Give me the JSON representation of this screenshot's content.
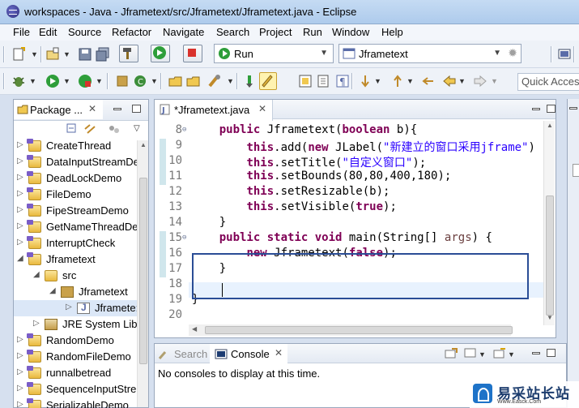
{
  "window": {
    "title": "workspaces - Java - Jframetext/src/Jframetext/Jframetext.java - Eclipse"
  },
  "menu": [
    "File",
    "Edit",
    "Source",
    "Refactor",
    "Navigate",
    "Search",
    "Project",
    "Run",
    "Window",
    "Help"
  ],
  "toolbar": {
    "run_config": "Run",
    "launch_target": "Jframetext",
    "quick_access_placeholder": "Quick Access"
  },
  "package_explorer": {
    "tab_label": "Package ...",
    "items": [
      {
        "label": "CreateThread",
        "level": 0,
        "twisty": "collapsed",
        "icon": "project-icon"
      },
      {
        "label": "DataInputStreamDe",
        "level": 0,
        "twisty": "collapsed",
        "icon": "project-icon"
      },
      {
        "label": "DeadLockDemo",
        "level": 0,
        "twisty": "collapsed",
        "icon": "project-icon"
      },
      {
        "label": "FileDemo",
        "level": 0,
        "twisty": "collapsed",
        "icon": "project-icon"
      },
      {
        "label": "FipeStreamDemo",
        "level": 0,
        "twisty": "collapsed",
        "icon": "project-icon"
      },
      {
        "label": "GetNameThreadDe",
        "level": 0,
        "twisty": "collapsed",
        "icon": "project-icon"
      },
      {
        "label": "InterruptCheck",
        "level": 0,
        "twisty": "collapsed",
        "icon": "project-icon"
      },
      {
        "label": "Jframetext",
        "level": 0,
        "twisty": "expanded",
        "icon": "project-icon"
      },
      {
        "label": "src",
        "level": 1,
        "twisty": "expanded",
        "icon": "source-folder-icon"
      },
      {
        "label": "Jframetext",
        "level": 2,
        "twisty": "expanded",
        "icon": "package-icon"
      },
      {
        "label": "Jframete:",
        "level": 3,
        "twisty": "collapsed",
        "icon": "java-file-icon"
      },
      {
        "label": "JRE System Libr",
        "level": 1,
        "twisty": "collapsed",
        "icon": "library-icon"
      },
      {
        "label": "RandomDemo",
        "level": 0,
        "twisty": "collapsed",
        "icon": "project-icon"
      },
      {
        "label": "RandomFileDemo",
        "level": 0,
        "twisty": "collapsed",
        "icon": "project-icon"
      },
      {
        "label": "runnalbetread",
        "level": 0,
        "twisty": "collapsed",
        "icon": "project-icon"
      },
      {
        "label": "SequenceInputStre",
        "level": 0,
        "twisty": "collapsed",
        "icon": "project-icon"
      },
      {
        "label": "SerializableDemo",
        "level": 0,
        "twisty": "collapsed",
        "icon": "project-icon"
      }
    ]
  },
  "editor": {
    "tab_label": "*Jframetext.java",
    "lines": [
      {
        "num": "8",
        "fold": true,
        "changed": false,
        "tokens": [
          [
            "",
            "    "
          ],
          [
            "kw",
            "public"
          ],
          [
            "",
            " Jframetext("
          ],
          [
            "kw",
            "boolean"
          ],
          [
            "",
            " b){"
          ]
        ]
      },
      {
        "num": "9",
        "fold": false,
        "changed": true,
        "tokens": [
          [
            "",
            "        "
          ],
          [
            "kw",
            "this"
          ],
          [
            "",
            ".add("
          ],
          [
            "kw",
            "new"
          ],
          [
            "",
            " JLabel("
          ],
          [
            "str",
            "\"新建立的窗口采用jframe\""
          ],
          [
            "",
            ")"
          ]
        ]
      },
      {
        "num": "10",
        "fold": false,
        "changed": true,
        "tokens": [
          [
            "",
            "        "
          ],
          [
            "kw",
            "this"
          ],
          [
            "",
            ".setTitle("
          ],
          [
            "str",
            "\"自定义窗口\""
          ],
          [
            "",
            ");"
          ]
        ]
      },
      {
        "num": "11",
        "fold": false,
        "changed": true,
        "tokens": [
          [
            "",
            "        "
          ],
          [
            "kw",
            "this"
          ],
          [
            "",
            ".setBounds(80,80,400,180);"
          ]
        ]
      },
      {
        "num": "12",
        "fold": false,
        "changed": false,
        "tokens": [
          [
            "",
            "        "
          ],
          [
            "kw",
            "this"
          ],
          [
            "",
            ".setResizable(b);"
          ]
        ]
      },
      {
        "num": "13",
        "fold": false,
        "changed": false,
        "tokens": [
          [
            "",
            "        "
          ],
          [
            "kw",
            "this"
          ],
          [
            "",
            ".setVisible("
          ],
          [
            "kw",
            "true"
          ],
          [
            "",
            ");"
          ]
        ]
      },
      {
        "num": "14",
        "fold": false,
        "changed": false,
        "tokens": [
          [
            "",
            "    }"
          ]
        ]
      },
      {
        "num": "15",
        "fold": true,
        "changed": true,
        "tokens": [
          [
            "",
            "    "
          ],
          [
            "kw",
            "public"
          ],
          [
            "",
            " "
          ],
          [
            "kw",
            "static"
          ],
          [
            "",
            " "
          ],
          [
            "kw",
            "void"
          ],
          [
            "",
            " main(String[] "
          ],
          [
            "vn",
            "args"
          ],
          [
            "",
            ") {"
          ]
        ]
      },
      {
        "num": "16",
        "fold": false,
        "changed": true,
        "tokens": [
          [
            "",
            "        "
          ],
          [
            "kw",
            "new"
          ],
          [
            "",
            " Jframetext("
          ],
          [
            "kw",
            "false"
          ],
          [
            "",
            ");"
          ]
        ]
      },
      {
        "num": "17",
        "fold": false,
        "changed": true,
        "tokens": [
          [
            "",
            "    }"
          ]
        ]
      },
      {
        "num": "18",
        "fold": false,
        "changed": false,
        "tokens": [
          [
            "",
            ""
          ]
        ]
      },
      {
        "num": "19",
        "fold": false,
        "changed": false,
        "tokens": [
          [
            "",
            "}"
          ]
        ]
      },
      {
        "num": "20",
        "fold": false,
        "changed": false,
        "tokens": [
          [
            "",
            ""
          ]
        ]
      }
    ]
  },
  "console": {
    "search_tab": "Search",
    "console_tab": "Console",
    "message": "No consoles to display at this time."
  },
  "watermark": {
    "name": "易采站长站",
    "url": "Www.Easck.Com"
  }
}
